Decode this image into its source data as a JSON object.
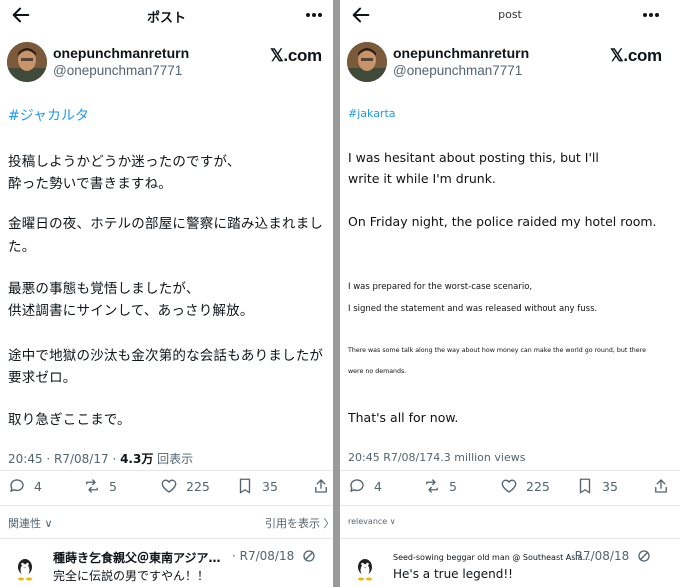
{
  "left": {
    "title": "ポスト",
    "display_name": "onepunchmanreturn",
    "handle": "@onepunchman7771",
    "brand": "𝕏.com",
    "hashtag": "#ジャカルタ",
    "lines": [
      "投稿しようかどうか迷ったのですが、",
      "酔った勢いで書きますね。",
      "金曜日の夜、ホテルの部屋に警察に踏み込まれまし",
      "た。",
      "最悪の事態も覚悟しましたが、",
      "供述調書にサインして、あっさり解放。",
      "途中で地獄の沙汰も金次第的な会話もありましたが",
      "要求ゼロ。",
      "取り急ぎここまで。"
    ],
    "meta_time": "20:45 · R7/08/17 · ",
    "meta_views": "4.3万",
    "meta_views_label": "回表示",
    "replies": "4",
    "reposts": "5",
    "likes": "225",
    "bookmarks": "35",
    "sort_label": "関連性 ∨",
    "sort_right": "引用を表示 〉",
    "reply": {
      "name": "種蒔き乞食親父＠東南アジア…",
      "date": "· R7/08/18",
      "text": "完全に伝説の男ですやん！！"
    }
  },
  "right": {
    "title": "post",
    "display_name": "onepunchmanreturn",
    "handle": "@onepunchman7771",
    "brand": "𝕏.com",
    "hashtag": "#jakarta",
    "lines": [
      "I was hesitant about posting this, but I'll",
      "write it while I'm drunk.",
      "On Friday night, the police raided my hotel room.",
      "I was prepared for the worst-case scenario,",
      "I signed the statement and was released without any fuss.",
      "There was some talk along the way about how money can make the world go round, but there",
      "were no demands.",
      "That's all for now."
    ],
    "meta": "20:45 R7/08/174.3 million views",
    "replies": "4",
    "reposts": "5",
    "likes": "225",
    "bookmarks": "35",
    "sort_label": "relevance ∨",
    "reply": {
      "name": "Seed-sowing beggar old man @ Southeast Asia...",
      "date": "· R7/08/18",
      "text": "He's a true legend!!"
    }
  },
  "icons": {
    "back": "back-arrow-icon",
    "more": "more-dots-icon",
    "reply": "reply-bubble-icon",
    "repost": "repost-icon",
    "like": "heart-icon",
    "bookmark": "bookmark-icon",
    "share": "share-icon",
    "mute": "mute-icon"
  },
  "colors": {
    "link": "#1d9bf0",
    "secondary": "#536471",
    "text": "#0f1419"
  }
}
